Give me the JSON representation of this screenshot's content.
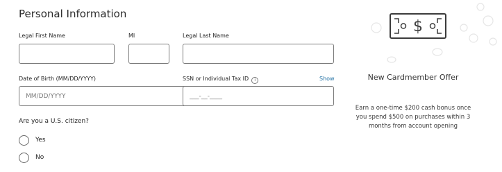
{
  "form": {
    "title": "Personal Information",
    "first_name": {
      "label": "Legal First Name",
      "value": ""
    },
    "mi": {
      "label": "MI",
      "value": ""
    },
    "last_name": {
      "label": "Legal Last Name",
      "value": ""
    },
    "dob": {
      "label": "Date of Birth (MM/DD/YYYY)",
      "placeholder": "MM/DD/YYYY",
      "value": ""
    },
    "ssn": {
      "label": "SSN or Individual Tax ID",
      "placeholder": "___-__-____",
      "value": "",
      "info_icon": "info-icon",
      "show_label": "Show"
    },
    "citizen": {
      "question": "Are you a U.S. citizen?",
      "options": [
        "Yes",
        "No"
      ]
    }
  },
  "offer": {
    "icon": "dollar-bill-icon",
    "title": "New Cardmember Offer",
    "text": "Earn a one-time $200 cash bonus once you spend $500 on purchases within 3 months from account opening"
  },
  "colors": {
    "link": "#1f6fa3",
    "border": "#7b7b7b",
    "text": "#2b2b2b"
  }
}
